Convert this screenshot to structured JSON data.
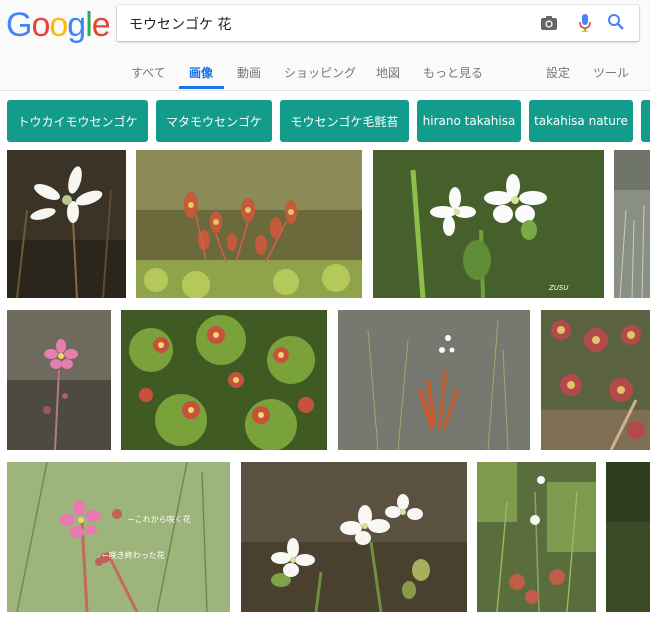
{
  "logo": {
    "letters": [
      "G",
      "o",
      "o",
      "g",
      "l",
      "e"
    ]
  },
  "search": {
    "query": "モウセンゴケ 花"
  },
  "icons": {
    "camera": "camera-icon",
    "mic": "mic-icon",
    "search": "search-icon"
  },
  "tabs": [
    "すべて",
    "画像",
    "動画",
    "ショッピング",
    "地図",
    "もっと見る"
  ],
  "tools": {
    "settings": "設定",
    "tools": "ツール"
  },
  "chips": [
    "トウカイモウセンゴケ",
    "マタモウセンゴケ",
    "モウセンゴケ毛氈苔",
    "hirano takahisa",
    "takahisa nature"
  ],
  "colors": {
    "accent": "#1a73e8",
    "chip_bg": "#139c8b"
  },
  "image_text": {
    "note1": "←これから咲く花",
    "note2": "←咲き終わった花",
    "watermark": "ZUSU"
  }
}
